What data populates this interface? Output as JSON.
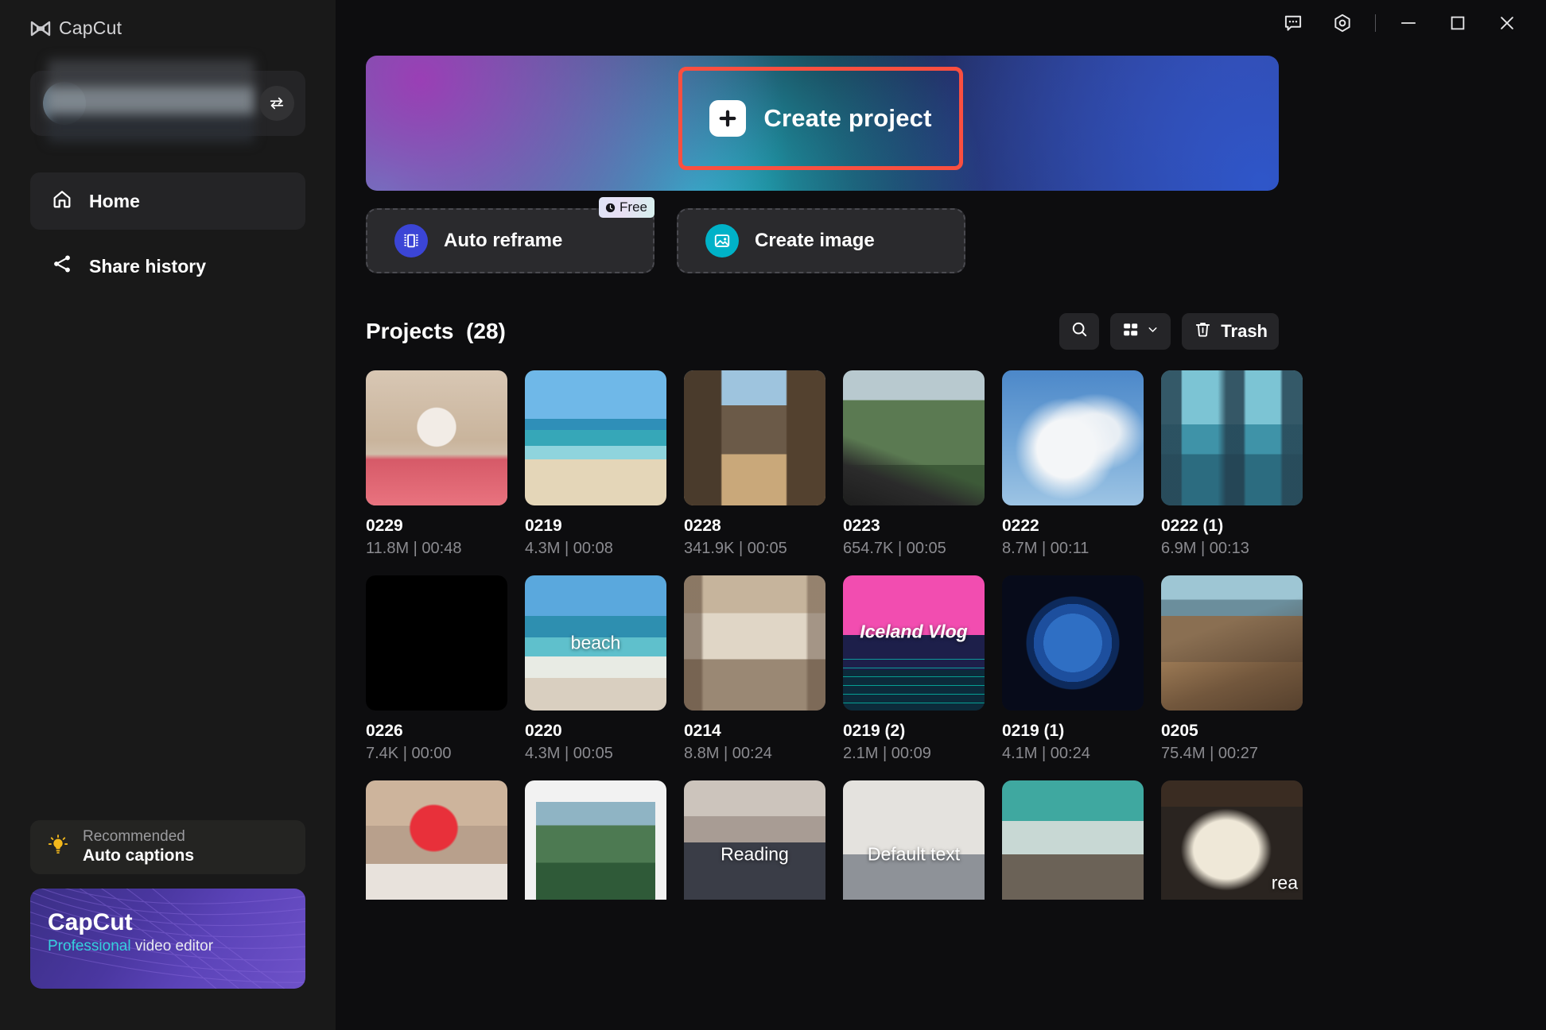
{
  "app": {
    "name": "CapCut",
    "logo_icon": "capcut-logo-icon"
  },
  "titlebar": {
    "feedback_icon": "feedback-bubble-icon",
    "settings_icon": "settings-hexagon-icon",
    "minimize_icon": "minimize-icon",
    "maximize_icon": "maximize-icon",
    "close_icon": "close-icon"
  },
  "sidebar": {
    "account": {
      "swap_icon": "switch-account-icon",
      "avatar_icon": "avatar"
    },
    "items": [
      {
        "label": "Home",
        "icon": "home-icon",
        "active": true
      },
      {
        "label": "Share history",
        "icon": "share-icon",
        "active": false
      }
    ],
    "promo_recommended": {
      "icon": "lightbulb-icon",
      "top_label": "Recommended",
      "bottom_label": "Auto captions"
    },
    "promo_card": {
      "title": "CapCut",
      "subtitle_accent": "Professional",
      "subtitle_rest": " video editor",
      "accent_color": "#35d0dd"
    }
  },
  "banner": {
    "create_project_label": "Create project",
    "plus_icon": "plus-icon",
    "highlight_color": "#fa4f40"
  },
  "feature_cards": [
    {
      "label": "Auto reframe",
      "icon": "auto-reframe-icon",
      "icon_color": "#3b45d6",
      "badge": {
        "label": "Free",
        "icon": "clock-icon"
      }
    },
    {
      "label": "Create image",
      "icon": "create-image-icon",
      "icon_color": "#00b2c8",
      "badge": null
    }
  ],
  "projects_section": {
    "title": "Projects",
    "count_label": "(28)",
    "tools": [
      {
        "name": "search",
        "icon": "search-icon",
        "label": ""
      },
      {
        "name": "view-mode",
        "icon": "grid-view-icon",
        "label": ""
      },
      {
        "name": "trash",
        "icon": "trash-icon",
        "label": "Trash"
      }
    ]
  },
  "projects": [
    {
      "name": "0229",
      "meta": "11.8M | 00:48",
      "overlay": "",
      "thumb": "family-kitchen"
    },
    {
      "name": "0219",
      "meta": "4.3M | 00:08",
      "overlay": "",
      "thumb": "tropical-beach"
    },
    {
      "name": "0228",
      "meta": "341.9K | 00:05",
      "overlay": "",
      "thumb": "game-village"
    },
    {
      "name": "0223",
      "meta": "654.7K | 00:05",
      "overlay": "",
      "thumb": "game-valley"
    },
    {
      "name": "0222",
      "meta": "8.7M | 00:11",
      "overlay": "",
      "thumb": "clouds-sky"
    },
    {
      "name": "0222 (1)",
      "meta": "6.9M | 00:13",
      "overlay": "",
      "thumb": "city-skyline"
    },
    {
      "name": "0226",
      "meta": "7.4K | 00:00",
      "overlay": "",
      "thumb": "black-blank"
    },
    {
      "name": "0220",
      "meta": "4.3M | 00:05",
      "overlay": "beach",
      "thumb": "ocean-beach"
    },
    {
      "name": "0214",
      "meta": "8.8M | 00:24",
      "overlay": "",
      "thumb": "living-room"
    },
    {
      "name": "0219 (2)",
      "meta": "2.1M | 00:09",
      "overlay": "Iceland Vlog",
      "thumb": "neon-retro"
    },
    {
      "name": "0219 (1)",
      "meta": "4.1M | 00:24",
      "overlay": "",
      "thumb": "earth-globe"
    },
    {
      "name": "0205",
      "meta": "75.4M | 00:27",
      "overlay": "",
      "thumb": "coastal-cliff"
    },
    {
      "name": "",
      "meta": "",
      "overlay": "",
      "thumb": "office-heart"
    },
    {
      "name": "",
      "meta": "",
      "overlay": "",
      "thumb": "phone-editor"
    },
    {
      "name": "",
      "meta": "",
      "overlay": "Reading",
      "thumb": "man-glasses"
    },
    {
      "name": "",
      "meta": "",
      "overlay": "Default text",
      "thumb": "classroom"
    },
    {
      "name": "",
      "meta": "",
      "overlay": "",
      "thumb": "ocean-waves"
    },
    {
      "name": "",
      "meta": "",
      "overlay": "rea",
      "thumb": "book-reading"
    }
  ]
}
